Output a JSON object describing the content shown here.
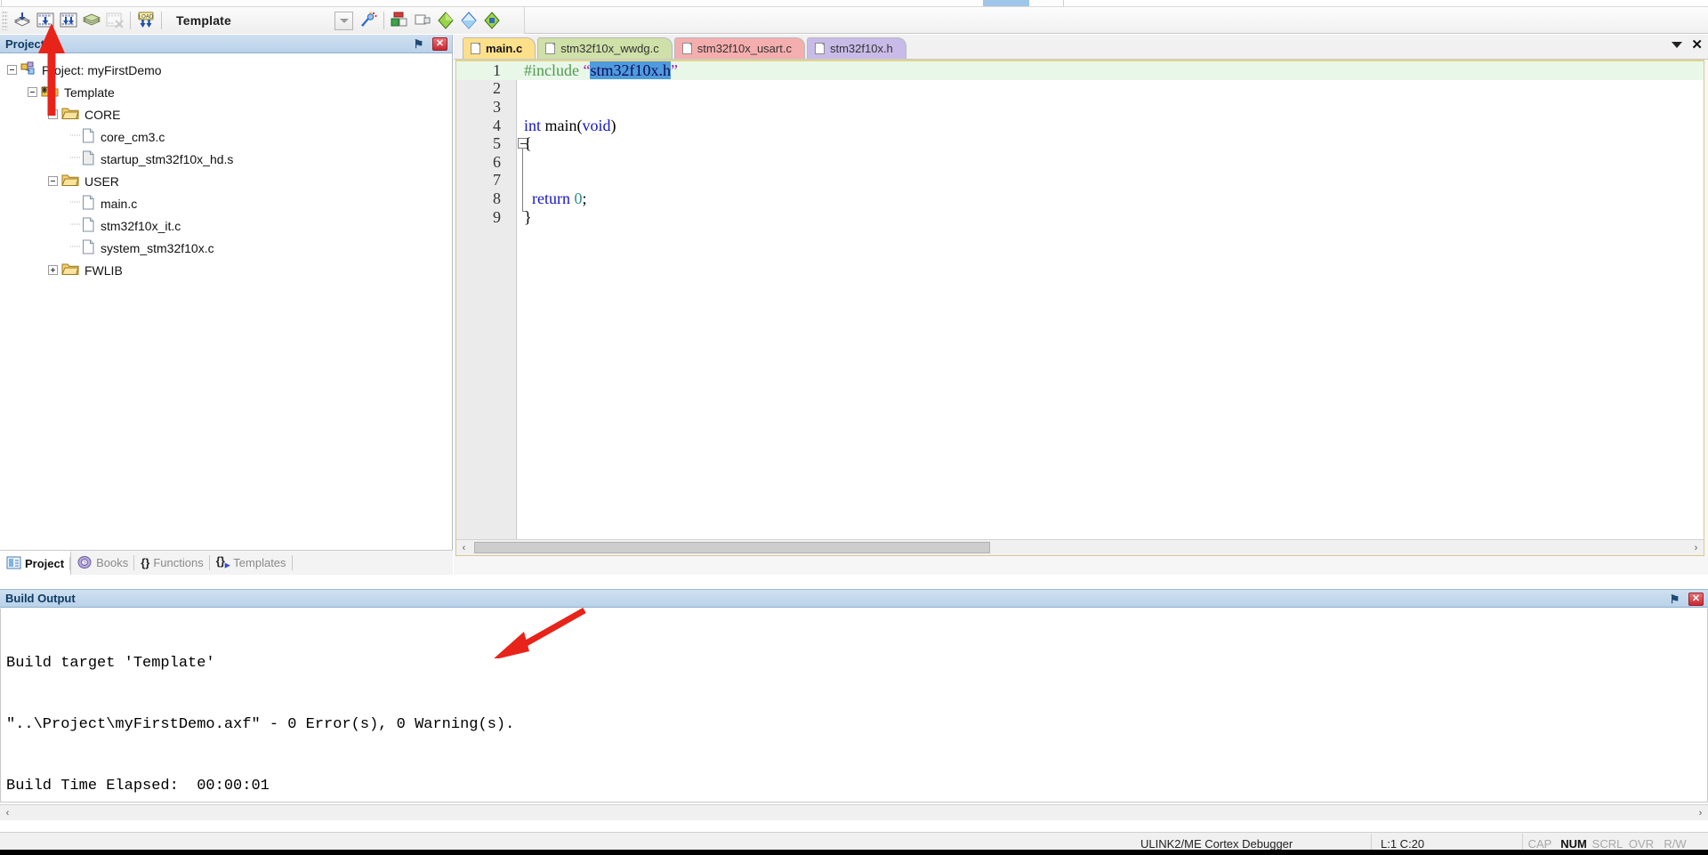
{
  "window": {
    "project_target": "Template"
  },
  "toolbar": {
    "icons": [
      {
        "name": "translate-icon",
        "title": "Translate"
      },
      {
        "name": "build-icon",
        "title": "Build"
      },
      {
        "name": "rebuild-icon",
        "title": "Rebuild"
      },
      {
        "name": "batch-build-icon",
        "title": "Batch Build"
      },
      {
        "name": "stop-build-icon",
        "title": "Stop Build"
      },
      {
        "name": "load-icon",
        "title": "Download"
      },
      {
        "name": "target-options-icon",
        "title": "Options for Target"
      },
      {
        "name": "manage-project-items-icon",
        "title": "Manage Project Items"
      },
      {
        "name": "pack-installer-icon",
        "title": "Pack Installer"
      },
      {
        "name": "manage-runtime-icon",
        "title": "Manage Run-Time Environment"
      },
      {
        "name": "select-software-packs-icon",
        "title": "Select Software Packs"
      }
    ],
    "target_combo_value": "Template"
  },
  "project_panel": {
    "title": "Project",
    "pin_glyph": "⚑",
    "close_glyph": "✕",
    "tree": [
      {
        "label": "Project: myFirstDemo",
        "depth": 0,
        "icon": "project-icon",
        "toggle": "minus"
      },
      {
        "label": "Template",
        "depth": 1,
        "icon": "target-icon",
        "toggle": "minus"
      },
      {
        "label": "CORE",
        "depth": 2,
        "icon": "folder-icon",
        "toggle": "minus"
      },
      {
        "label": "core_cm3.c",
        "depth": 3,
        "icon": "c-file-icon",
        "toggle": "none"
      },
      {
        "label": "startup_stm32f10x_hd.s",
        "depth": 3,
        "icon": "asm-file-icon",
        "toggle": "none"
      },
      {
        "label": "USER",
        "depth": 2,
        "icon": "folder-icon",
        "toggle": "minus"
      },
      {
        "label": "main.c",
        "depth": 3,
        "icon": "c-file-icon",
        "toggle": "none"
      },
      {
        "label": "stm32f10x_it.c",
        "depth": 3,
        "icon": "c-file-icon",
        "toggle": "none"
      },
      {
        "label": "system_stm32f10x.c",
        "depth": 3,
        "icon": "c-file-icon",
        "toggle": "none"
      },
      {
        "label": "FWLIB",
        "depth": 2,
        "icon": "folder-icon",
        "toggle": "plus"
      }
    ],
    "tabs": [
      {
        "label": "Project",
        "icon": "project-tab-icon",
        "active": true
      },
      {
        "label": "Books",
        "icon": "books-tab-icon",
        "active": false
      },
      {
        "label": "Functions",
        "icon": "functions-tab-icon",
        "active": false
      },
      {
        "label": "Templates",
        "icon": "templates-tab-icon",
        "active": false
      }
    ]
  },
  "editor": {
    "tabs": [
      {
        "label": "main.c",
        "color": "#ffe08a",
        "active": true
      },
      {
        "label": "stm32f10x_wwdg.c",
        "color": "#cfe0a8",
        "active": false
      },
      {
        "label": "stm32f10x_usart.c",
        "color": "#f5aeae",
        "active": false
      },
      {
        "label": "stm32f10x.h",
        "color": "#c8bbe8",
        "active": false
      }
    ],
    "tabbar_buttons": [
      {
        "name": "tab-list-dropdown",
        "glyph": "▼"
      },
      {
        "name": "close-document-button",
        "glyph": "✕"
      }
    ],
    "lines": [
      {
        "n": "1",
        "highlight": true,
        "segments": [
          {
            "t": "#include ",
            "cls": "k-pre"
          },
          {
            "t": "“",
            "cls": "k-str"
          },
          {
            "t": "stm32f10x.h",
            "cls": "sel-text"
          },
          {
            "t": "”",
            "cls": "k-str"
          }
        ]
      },
      {
        "n": "2",
        "highlight": false,
        "segments": []
      },
      {
        "n": "3",
        "highlight": false,
        "segments": []
      },
      {
        "n": "4",
        "highlight": false,
        "segments": [
          {
            "t": "int ",
            "cls": "k-kw"
          },
          {
            "t": "main(",
            "cls": ""
          },
          {
            "t": "void",
            "cls": "k-kw"
          },
          {
            "t": ")",
            "cls": ""
          }
        ]
      },
      {
        "n": "5",
        "highlight": false,
        "segments": [
          {
            "t": "{",
            "cls": ""
          }
        ]
      },
      {
        "n": "6",
        "highlight": false,
        "segments": []
      },
      {
        "n": "7",
        "highlight": false,
        "segments": []
      },
      {
        "n": "8",
        "highlight": false,
        "segments": [
          {
            "t": "  ",
            "cls": ""
          },
          {
            "t": "return ",
            "cls": "k-kw"
          },
          {
            "t": "0",
            "cls": "k-num"
          },
          {
            "t": ";",
            "cls": ""
          }
        ]
      },
      {
        "n": "9",
        "highlight": false,
        "segments": [
          {
            "t": "}",
            "cls": ""
          }
        ]
      }
    ],
    "hscroll": {
      "left_glyph": "‹",
      "right_glyph": "›"
    }
  },
  "build_output": {
    "title": "Build Output",
    "lines": [
      "Build target 'Template'",
      "\"..\\Project\\myFirstDemo.axf\" - 0 Error(s), 0 Warning(s).",
      "Build Time Elapsed:  00:00:01"
    ],
    "scroll": {
      "left_glyph": "‹",
      "right_glyph": "›"
    }
  },
  "status_bar": {
    "debugger": "ULINK2/ME Cortex Debugger",
    "cursor": "L:1 C:20",
    "indicators": [
      {
        "label": "CAP",
        "on": false
      },
      {
        "label": "NUM",
        "on": true
      },
      {
        "label": "SCRL",
        "on": false
      },
      {
        "label": "OVR",
        "on": false
      },
      {
        "label": "R/W",
        "on": false
      }
    ]
  },
  "annotations": {
    "arrow_color": "#e8231a",
    "arrows": [
      {
        "name": "arrow-to-build-button",
        "points_to": "build-icon"
      },
      {
        "name": "arrow-to-build-result",
        "points_to": "build-output-result-line"
      }
    ]
  }
}
